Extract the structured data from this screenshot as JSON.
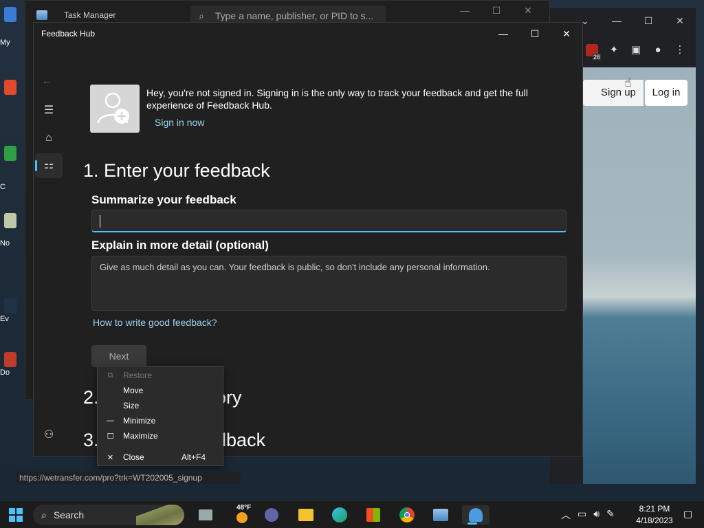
{
  "desktop": {
    "icons": [
      {
        "label": "My"
      },
      {
        "label": ""
      },
      {
        "label": "C"
      },
      {
        "label": "No"
      },
      {
        "label": "Ev"
      },
      {
        "label": "Do"
      }
    ]
  },
  "task_manager": {
    "title": "Task Manager",
    "search_placeholder": "Type a name, publisher, or PID to s..."
  },
  "browser": {
    "ext_badge": "26",
    "signup_label": "Sign up",
    "login_label": "Log in",
    "status_url": "https://wetransfer.com/pro?trk=WT202005_signup"
  },
  "feedback_hub": {
    "title": "Feedback Hub",
    "signin_message": "Hey, you're not signed in. Signing in is the only way to track your feedback and get the full experience of Feedback Hub.",
    "signin_link": "Sign in now",
    "step1_title": "1. Enter your feedback",
    "summary_label": "Summarize your feedback",
    "summary_value": "",
    "detail_label": "Explain in more detail (optional)",
    "detail_placeholder": "Give as much detail as you can. Your feedback is public, so don't include any personal information.",
    "help_link": "How to write good feedback?",
    "next_label": "Next",
    "step2_title_start": "2.",
    "step2_title_end": "gory",
    "step3_title_start": "3.",
    "step3_title_end": "edback"
  },
  "context_menu": {
    "items": [
      {
        "label": "Restore",
        "shortcut": "",
        "disabled": true,
        "icon": "restore-icon"
      },
      {
        "label": "Move",
        "shortcut": "",
        "disabled": false,
        "icon": ""
      },
      {
        "label": "Size",
        "shortcut": "",
        "disabled": false,
        "icon": ""
      },
      {
        "label": "Minimize",
        "shortcut": "",
        "disabled": false,
        "icon": "minimize-icon"
      },
      {
        "label": "Maximize",
        "shortcut": "",
        "disabled": false,
        "icon": "maximize-icon"
      },
      {
        "label": "Close",
        "shortcut": "Alt+F4",
        "disabled": false,
        "icon": "close-icon"
      }
    ]
  },
  "taskbar": {
    "search_label": "Search",
    "weather_temp": "48°F",
    "time": "8:21 PM",
    "date": "4/18/2023"
  },
  "colors": {
    "accent": "#4cc2ff",
    "link": "#9fd2ef",
    "window_bg": "#202020"
  }
}
